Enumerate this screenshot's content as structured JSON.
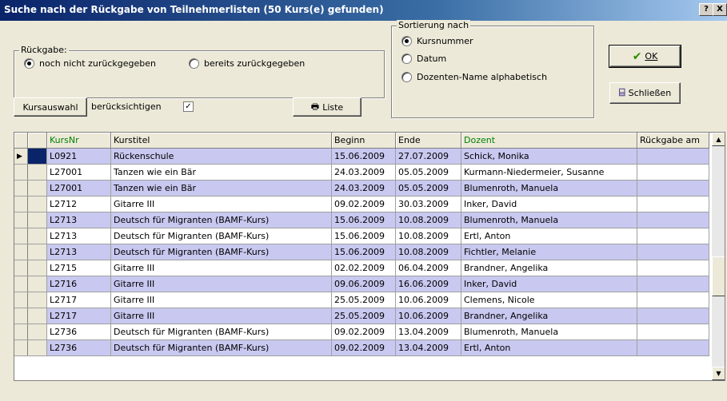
{
  "window": {
    "title": "Suche nach der Rückgabe von Teilnehmerlisten (50 Kurs(e) gefunden)",
    "help_label": "?",
    "close_label": "X"
  },
  "rueckgabe": {
    "legend": "Rückgabe:",
    "option1": "noch nicht zurückgegeben",
    "option2": "bereits zurückgegeben",
    "selected": "option1"
  },
  "sortierung": {
    "legend": "Sortierung nach",
    "option1": "Kursnummer",
    "option2": "Datum",
    "option3": "Dozenten-Name alphabetisch",
    "selected": "option1"
  },
  "buttons": {
    "ok": "OK",
    "close": "Schließen",
    "kursauswahl": "Kursauswahl",
    "liste": "Liste"
  },
  "beruecksichtigen": {
    "label": "berücksichtigen",
    "checked": true
  },
  "grid": {
    "columns": [
      "KursNr",
      "Kurstitel",
      "Beginn",
      "Ende",
      "Dozent",
      "Rückgabe am"
    ],
    "rows": [
      [
        "L0921",
        "Rückenschule",
        "15.06.2009",
        "27.07.2009",
        "Schick, Monika",
        ""
      ],
      [
        "L27001",
        "Tanzen wie ein Bär",
        "24.03.2009",
        "05.05.2009",
        "Kurmann-Niedermeier, Susanne",
        ""
      ],
      [
        "L27001",
        "Tanzen wie ein Bär",
        "24.03.2009",
        "05.05.2009",
        "Blumenroth, Manuela",
        ""
      ],
      [
        "L2712",
        "Gitarre III",
        "09.02.2009",
        "30.03.2009",
        "Inker, David",
        ""
      ],
      [
        "L2713",
        "Deutsch für Migranten (BAMF-Kurs)",
        "15.06.2009",
        "10.08.2009",
        "Blumenroth, Manuela",
        ""
      ],
      [
        "L2713",
        "Deutsch für Migranten (BAMF-Kurs)",
        "15.06.2009",
        "10.08.2009",
        "Ertl, Anton",
        ""
      ],
      [
        "L2713",
        "Deutsch für Migranten (BAMF-Kurs)",
        "15.06.2009",
        "10.08.2009",
        "Fichtler, Melanie",
        ""
      ],
      [
        "L2715",
        "Gitarre III",
        "02.02.2009",
        "06.04.2009",
        "Brandner, Angelika",
        ""
      ],
      [
        "L2716",
        "Gitarre III",
        "09.06.2009",
        "16.06.2009",
        "Inker, David",
        ""
      ],
      [
        "L2717",
        "Gitarre III",
        "25.05.2009",
        "10.06.2009",
        "Clemens, Nicole",
        ""
      ],
      [
        "L2717",
        "Gitarre III",
        "25.05.2009",
        "10.06.2009",
        "Brandner, Angelika",
        ""
      ],
      [
        "L2736",
        "Deutsch für Migranten (BAMF-Kurs)",
        "09.02.2009",
        "13.04.2009",
        "Blumenroth, Manuela",
        ""
      ],
      [
        "L2736",
        "Deutsch für Migranten (BAMF-Kurs)",
        "09.02.2009",
        "13.04.2009",
        "Ertl, Anton",
        ""
      ]
    ]
  }
}
